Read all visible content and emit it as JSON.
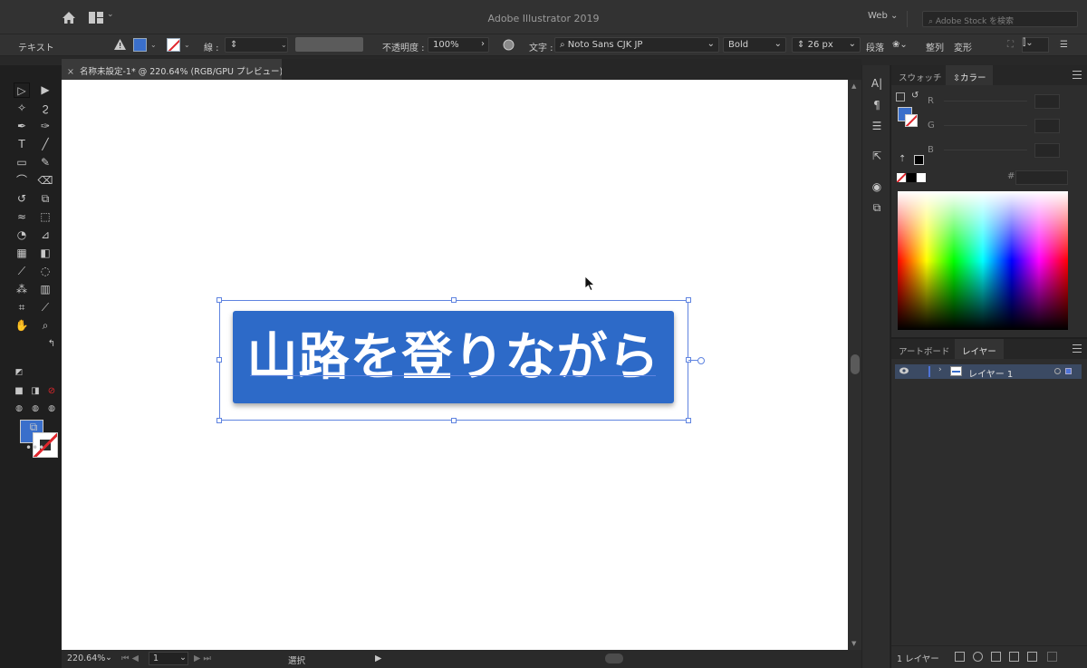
{
  "app": {
    "window_title": "Adobe Illustrator 2019",
    "workspace": "Web",
    "stock_search_placeholder": "Adobe Stock を検索"
  },
  "control_bar": {
    "context_label": "テキスト",
    "stroke_label": "線 :",
    "opacity_label": "不透明度 :",
    "opacity_value": "100%",
    "character_label": "文字 :",
    "font_family": "Noto Sans CJK JP",
    "font_style": "Bold",
    "font_size": "26 px",
    "paragraph_label": "段落",
    "align_label": "整列",
    "transform_label": "変形"
  },
  "document": {
    "tab_title": "名称未設定-1* @ 220.64% (RGB/GPU プレビュー)",
    "button_text": "山路を登りながら",
    "button_color": "#2d6ac8"
  },
  "status_bar": {
    "zoom": "220.64%",
    "artboard_number": "1",
    "mode": "選択"
  },
  "color_panel": {
    "tabs": [
      "スウォッチ",
      "カラー"
    ],
    "channels": [
      "R",
      "G",
      "B"
    ],
    "hex_label": "#"
  },
  "layers_panel": {
    "tabs": [
      "アートボード",
      "レイヤー"
    ],
    "layer_name": "レイヤー 1",
    "footer_count": "1 レイヤー"
  },
  "colors": {
    "fill": "#3a6fcb",
    "selection": "#5f84e0"
  }
}
